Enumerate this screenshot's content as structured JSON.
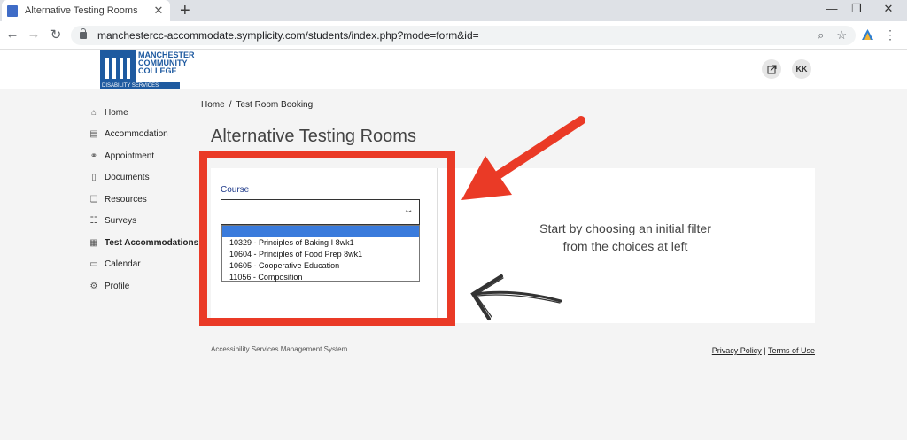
{
  "browser": {
    "tab_title": "Alternative Testing Rooms",
    "tab_close": "✕",
    "new_tab": "+",
    "url": "manchestercc-accommodate.symplicity.com/students/index.php?mode=form&id="
  },
  "header": {
    "logo_lines": [
      "MANCHESTER",
      "COMMUNITY",
      "COLLEGE"
    ],
    "logo_sub": "DISABILITY SERVICES",
    "user_initials": "KK"
  },
  "sidebar": {
    "items": [
      {
        "label": "Home",
        "icon": "home-icon"
      },
      {
        "label": "Accommodation",
        "icon": "accommodation-icon"
      },
      {
        "label": "Appointment",
        "icon": "appointment-icon"
      },
      {
        "label": "Documents",
        "icon": "documents-icon"
      },
      {
        "label": "Resources",
        "icon": "resources-icon"
      },
      {
        "label": "Surveys",
        "icon": "surveys-icon"
      },
      {
        "label": "Test Accommodations",
        "icon": "test-accommodations-icon"
      },
      {
        "label": "Calendar",
        "icon": "calendar-icon"
      },
      {
        "label": "Profile",
        "icon": "profile-icon"
      }
    ]
  },
  "breadcrumb": {
    "home": "Home",
    "sep": "/",
    "current": "Test Room Booking"
  },
  "page": {
    "title": "Alternative Testing Rooms"
  },
  "form": {
    "course_label": "Course",
    "options": [
      "",
      "10329 - Principles of Baking I 8wk1",
      "10604 - Principles of Food Prep 8wk1",
      "10605 - Cooperative Education",
      "11056 - Composition"
    ]
  },
  "hint": "Start by choosing an initial filter from the choices at left",
  "footer": {
    "system_name": "Accessibility Services Management System",
    "privacy": "Privacy Policy",
    "divider": "|",
    "terms": "Terms of Use"
  },
  "colors": {
    "annotation_red": "#ea3a26",
    "brand_blue": "#1e5aa0",
    "selected_option": "#3a7bdc"
  }
}
